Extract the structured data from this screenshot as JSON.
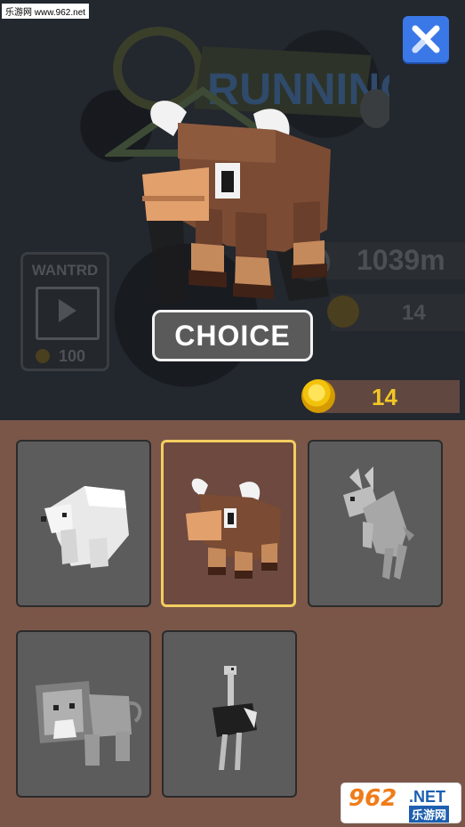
{
  "watermark_top": "乐游网 www.962.net",
  "logo": {
    "text": "RUNNING ZOO"
  },
  "wanted_panel": {
    "title": "WANTRD",
    "cost": "100",
    "icons": [
      "video-play-icon",
      "coin-icon"
    ]
  },
  "distance": {
    "value": "1039m"
  },
  "coins_dim": {
    "value": "14"
  },
  "choice_button": {
    "label": "CHOICE"
  },
  "coins": {
    "value": "14"
  },
  "animals": [
    {
      "name": "polar-bear",
      "selected": false,
      "locked": true
    },
    {
      "name": "bull",
      "selected": true,
      "locked": false
    },
    {
      "name": "kangaroo",
      "selected": false,
      "locked": true
    },
    {
      "name": "lion",
      "selected": false,
      "locked": true
    },
    {
      "name": "ostrich",
      "selected": false,
      "locked": true
    }
  ],
  "watermark_bottom": {
    "brand": "962",
    "tld": ".NET",
    "cn": "乐游网"
  },
  "colors": {
    "selected_border": "#f3cd5f",
    "close_button": "#3b78e7",
    "coin": "#f3c20c",
    "panel_bg": "#7a5649"
  }
}
